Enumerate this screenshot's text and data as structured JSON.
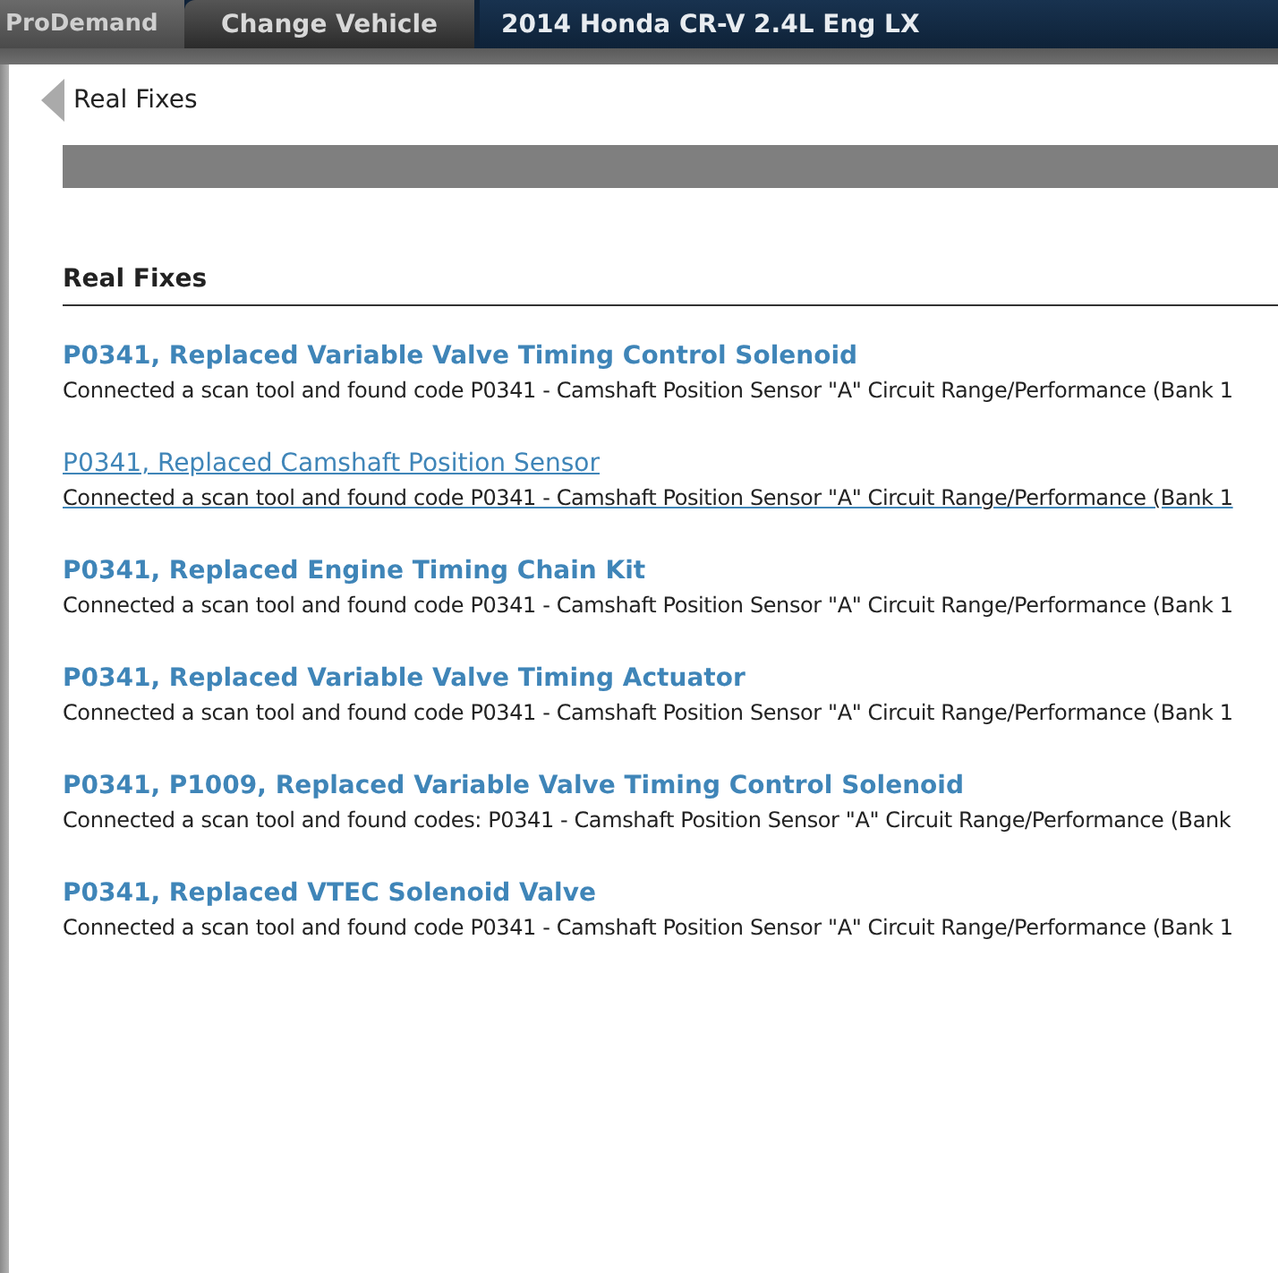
{
  "top_bar": {
    "logo": "ProDemand",
    "change_button": "Change Vehicle",
    "vehicle": "2014 Honda CR-V 2.4L Eng LX"
  },
  "panel": {
    "back_label": "Real Fixes",
    "section_title": "Real Fixes",
    "fixes": [
      {
        "title": "P0341, Replaced Variable Valve Timing Control Solenoid",
        "summary": "Connected a scan tool and found code P0341 - Camshaft Position Sensor \"A\" Circuit Range/Performance (Bank 1",
        "hovered": false
      },
      {
        "title": "P0341, Replaced Camshaft Position Sensor",
        "summary": "Connected a scan tool and found code P0341 - Camshaft Position Sensor \"A\" Circuit Range/Performance (Bank 1",
        "hovered": true
      },
      {
        "title": "P0341, Replaced Engine Timing Chain Kit",
        "summary": "Connected a scan tool and found code P0341 - Camshaft Position Sensor \"A\" Circuit Range/Performance (Bank 1",
        "hovered": false
      },
      {
        "title": "P0341, Replaced Variable Valve Timing Actuator",
        "summary": "Connected a scan tool and found code P0341 - Camshaft Position Sensor \"A\" Circuit Range/Performance (Bank 1",
        "hovered": false
      },
      {
        "title": "P0341, P1009, Replaced Variable Valve Timing Control Solenoid",
        "summary": "Connected a scan tool and found codes: P0341 - Camshaft Position Sensor \"A\" Circuit Range/Performance (Bank",
        "hovered": false
      },
      {
        "title": "P0341, Replaced VTEC Solenoid Valve",
        "summary": "Connected a scan tool and found code P0341 - Camshaft Position Sensor \"A\" Circuit Range/Performance (Bank 1",
        "hovered": false
      }
    ]
  }
}
